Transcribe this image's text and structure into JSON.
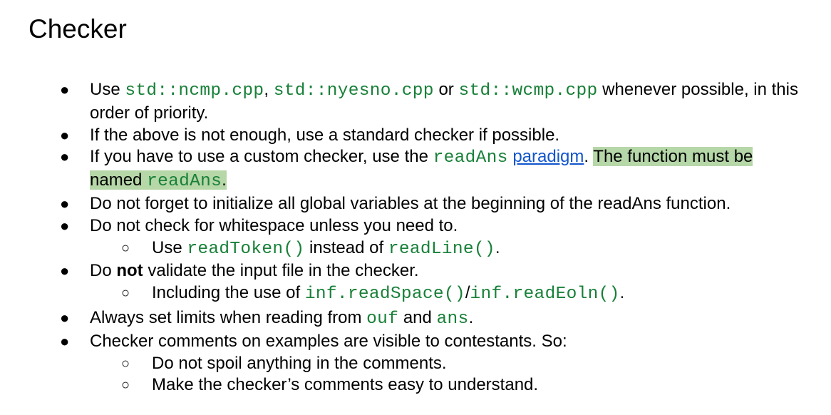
{
  "title": "Checker",
  "bullets": {
    "primary": "●",
    "secondary": "○"
  },
  "item1": {
    "t1": "Use ",
    "c1": "std::ncmp.cpp",
    "t2": ", ",
    "c2": "std::nyesno.cpp",
    "t3": " or ",
    "c3": "std::wcmp.cpp",
    "t4": " whenever possible, in this order of priority."
  },
  "item2": {
    "t1": "If the above is not enough, use a standard checker if possible."
  },
  "item3": {
    "t1": "If you have to use a custom checker, use the ",
    "c1": "readAns",
    "t2": " ",
    "link": "paradigm",
    "t3": ". ",
    "h1": "The function must be named ",
    "c2": "readAns",
    "h2": "."
  },
  "item4": {
    "t1": "Do not forget to initialize all global variables at the beginning of the readAns function."
  },
  "item5": {
    "t1": "Do not check for whitespace unless you need to.",
    "sub1": {
      "t1": "Use ",
      "c1": "readToken()",
      "t2": " instead of ",
      "c2": "readLine()",
      "t3": "."
    }
  },
  "item6": {
    "t1": "Do ",
    "b1": "not",
    "t2": " validate the input file in the checker.",
    "sub1": {
      "t1": "Including the use of ",
      "c1": "inf.readSpace()",
      "t2": "/",
      "c2": "inf.readEoln()",
      "t3": "."
    }
  },
  "item7": {
    "t1": "Always set limits when reading from ",
    "c1": "ouf",
    "t2": " and ",
    "c2": "ans",
    "t3": "."
  },
  "item8": {
    "t1": "Checker comments on examples are visible to contestants. So:",
    "sub1": {
      "t1": "Do not spoil anything in the comments."
    },
    "sub2": {
      "t1": "Make the checker’s comments easy to understand."
    }
  }
}
